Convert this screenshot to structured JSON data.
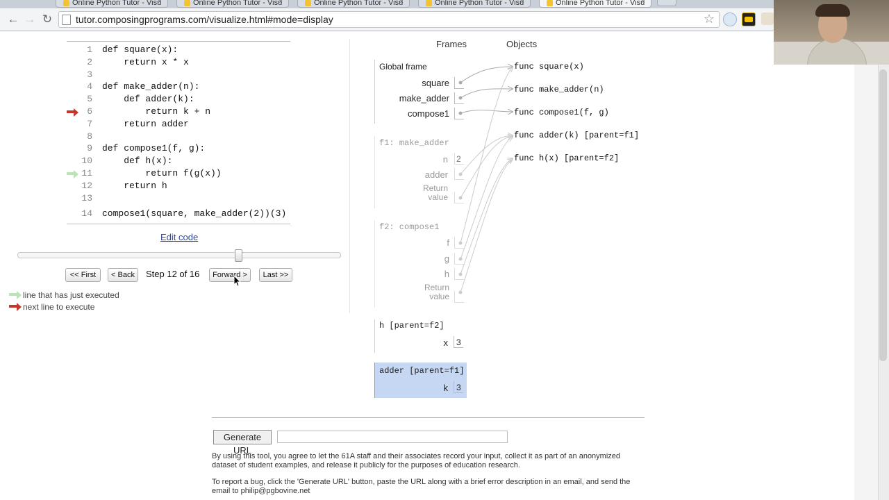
{
  "browser": {
    "tabs": [
      {
        "title": "Online Python Tutor - Visu",
        "active": false
      },
      {
        "title": "Online Python Tutor - Visu",
        "active": false
      },
      {
        "title": "Online Python Tutor - Visu",
        "active": false
      },
      {
        "title": "Online Python Tutor - Visu",
        "active": false
      },
      {
        "title": "Online Python Tutor - Visu",
        "active": true
      }
    ],
    "url": "tutor.composingprograms.com/visualize.html#mode=display",
    "back_icon": "←",
    "forward_icon": "→",
    "reload_icon": "↻",
    "star_icon": "☆",
    "close_tab": "×"
  },
  "code": {
    "lines": [
      {
        "num": "1",
        "text": "def square(x):"
      },
      {
        "num": "2",
        "text": "    return x * x"
      },
      {
        "num": "3",
        "text": ""
      },
      {
        "num": "4",
        "text": "def make_adder(n):"
      },
      {
        "num": "5",
        "text": "    def adder(k):"
      },
      {
        "num": "6",
        "text": "        return k + n"
      },
      {
        "num": "7",
        "text": "    return adder"
      },
      {
        "num": "8",
        "text": ""
      },
      {
        "num": "9",
        "text": "def compose1(f, g):"
      },
      {
        "num": "10",
        "text": "    def h(x):"
      },
      {
        "num": "11",
        "text": "        return f(g(x))"
      },
      {
        "num": "12",
        "text": "    return h"
      },
      {
        "num": "13",
        "text": ""
      },
      {
        "num": "14",
        "text": "compose1(square, make_adder(2))(3)"
      }
    ],
    "next_line": "6",
    "just_executed_line": "11"
  },
  "controls": {
    "edit_code": "Edit code",
    "first": "<< First",
    "back": "< Back",
    "step_text": "Step 12 of 16",
    "step_progress": 0.6875,
    "forward": "Forward >",
    "last": "Last >>"
  },
  "legend": {
    "executed": "line that has just executed",
    "next": "next line to execute"
  },
  "viz": {
    "frames_header": "Frames",
    "objects_header": "Objects",
    "global": {
      "title": "Global frame",
      "vars": [
        "square",
        "make_adder",
        "compose1"
      ]
    },
    "f1": {
      "title": "f1: make_adder",
      "n_label": "n",
      "n_value": "2",
      "adder_label": "adder",
      "return_label": "Return value"
    },
    "f2": {
      "title": "f2: compose1",
      "vars": [
        "f",
        "g",
        "h"
      ],
      "return_label": "Return value"
    },
    "h_frame": {
      "title": "h [parent=f2]",
      "var": "x",
      "value": "3"
    },
    "adder_frame": {
      "title": "adder [parent=f1]",
      "var": "k",
      "value": "3"
    },
    "objects": [
      "func square(x)",
      "func make_adder(n)",
      "func compose1(f, g)",
      "func adder(k) [parent=f1]",
      "func h(x) [parent=f2]"
    ]
  },
  "footer": {
    "generate_url": "Generate URL",
    "para1": "By using this tool, you agree to let the 61A staff and their associates record your input, collect it as part of an anonymized dataset of student examples, and release it publicly for the purposes of education research.",
    "para2": "To report a bug, click the 'Generate URL' button, paste the URL along with a brief error description in an email, and send the email to philip@pgbovine.net"
  }
}
